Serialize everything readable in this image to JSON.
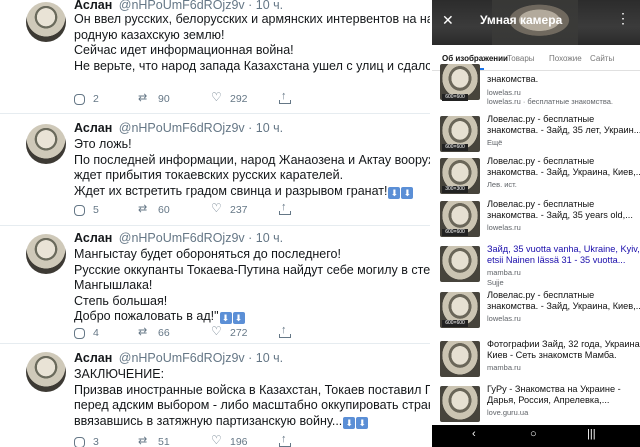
{
  "tweets": [
    {
      "name": "Аслан",
      "handle": "@nHPoUmF6dROjz9v",
      "time": "· 10 ч.",
      "lines": [
        "Он ввел русских, белорусских и армянских интервентов на нашу",
        "родную казахскую землю!",
        "Сейчас идет информационная война!",
        "Не верьте, что народ запада Казахстана ушел с улиц и сдался."
      ],
      "emoji_suffix": "",
      "replies": "2",
      "retweets": "90",
      "likes": "292"
    },
    {
      "name": "Аслан",
      "handle": "@nHPoUmF6dROjz9v",
      "time": "· 10 ч.",
      "lines": [
        "Это ложь!",
        "По последней информации, народ Жанаозена и Актау вооружен и",
        "ждет прибытия токаевских русских карателей.",
        "Ждет их встретить градом свинца и разрывом гранат!"
      ],
      "emoji_suffix": "⬇⬇",
      "replies": "5",
      "retweets": "60",
      "likes": "237"
    },
    {
      "name": "Аслан",
      "handle": "@nHPoUmF6dROjz9v",
      "time": "· 10 ч.",
      "lines": [
        "Мангыстау будет обороняться до последнего!",
        "Русские оккупанты Токаева-Путина найдут себе могилу в степях",
        "Мангышлака!",
        "Степь большая!",
        "Добро пожаловать в ад!\""
      ],
      "emoji_suffix": "⬇⬇",
      "replies": "4",
      "retweets": "66",
      "likes": "272"
    },
    {
      "name": "Аслан",
      "handle": "@nHPoUmF6dROjz9v",
      "time": "· 10 ч.",
      "lines": [
        "ЗАКЛЮЧЕНИЕ:",
        "Призвав иностранные войска в Казахстан,  Токаев поставил Путло",
        "перед адским выбором - либо масштабно оккупировать страну,",
        "ввязавшись в затяжную партизанскую войну..."
      ],
      "emoji_suffix": "⬇⬇",
      "replies": "3",
      "retweets": "51",
      "likes": "196"
    }
  ],
  "phone": {
    "header_title": "Умная камера",
    "tabs": [
      "Об изображении",
      "Товары",
      "Похожие",
      "Сайты"
    ],
    "results": [
      {
        "lines": [
          "знакомства."
        ],
        "source": "lowelas.ru",
        "badge": "600×600"
      },
      {
        "lines": [
          "Ловелас.ру - бесплатные знакомства."
        ],
        "source": "",
        "badge": ""
      },
      {
        "lines": [
          "Ловелас.ру - бесплатные",
          "знакомства. - Зайд, 35 лет, Украин..."
        ],
        "source": "Ещё",
        "badge": "600×600"
      },
      {
        "lines": [
          "Ловелас.ру - бесплатные",
          "знакомства. - Зайд, Украина, Киев,..."
        ],
        "source": "Лев. ист.",
        "badge": "300×300"
      },
      {
        "lines": [
          "Ловелас.ру - бесплатные",
          "знакомства. - Зайд, 35 years old,..."
        ],
        "source": "lowelas.ru",
        "badge": "600×600"
      },
      {
        "lines": [
          "Зайд, 35 vuotta vanha, Ukraine, Kyiv,",
          "etsii Nainen lässä 31 - 35 vuotta..."
        ],
        "source": "mamba.ru",
        "badge": ""
      },
      {
        "lines": [
          "Ловелас.ру - бесплатные",
          "знакомства. - Зайд, Украина, Киев,..."
        ],
        "source": "lowelas.ru",
        "badge": "600×600"
      },
      {
        "lines": [
          "Фотографии Зайд, 32 года, Украина,",
          "Киев - Сеть знакомств Мамба."
        ],
        "source": "mamba.ru",
        "badge": ""
      },
      {
        "lines": [
          "ГуРу - Знакомства на Украине -",
          "Дарья, Россия, Апрелевка,..."
        ],
        "source": "love.guru.ua",
        "badge": ""
      }
    ],
    "result_source_extras": [
      "lowelas.ru · бесплатные знакомства.",
      "Sujje"
    ]
  }
}
